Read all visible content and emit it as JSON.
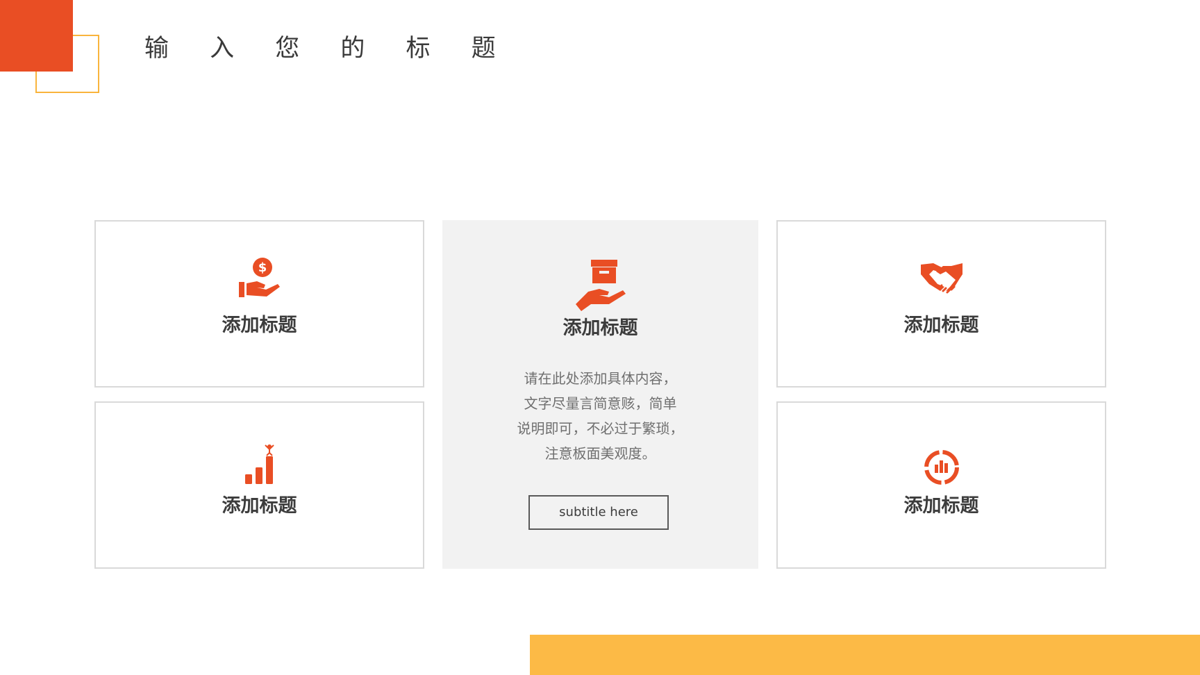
{
  "page": {
    "title": "输 入 您 的 标 题"
  },
  "colors": {
    "accent": "#e94e24",
    "secondary": "#f9b43c",
    "bar": "#fcba46",
    "card_border": "#d9d9d9",
    "center_bg": "#f2f2f2",
    "text_dark": "#3c3c3c",
    "text_muted": "#6f6f6f"
  },
  "cards": {
    "top_left": {
      "icon": "money-hand-icon",
      "title": "添加标题"
    },
    "top_right": {
      "icon": "handshake-icon",
      "title": "添加标题"
    },
    "bottom_left": {
      "icon": "growth-chart-icon",
      "title": "添加标题"
    },
    "bottom_right": {
      "icon": "chart-circle-icon",
      "title": "添加标题"
    }
  },
  "center": {
    "icon": "box-hand-icon",
    "title": "添加标题",
    "description_lines": [
      "请在此处添加具体内容，",
      "文字尽量言简意赅，简单",
      "说明即可，不必过于繁琐，",
      "注意板面美观度。"
    ],
    "button_label": "subtitle here"
  }
}
